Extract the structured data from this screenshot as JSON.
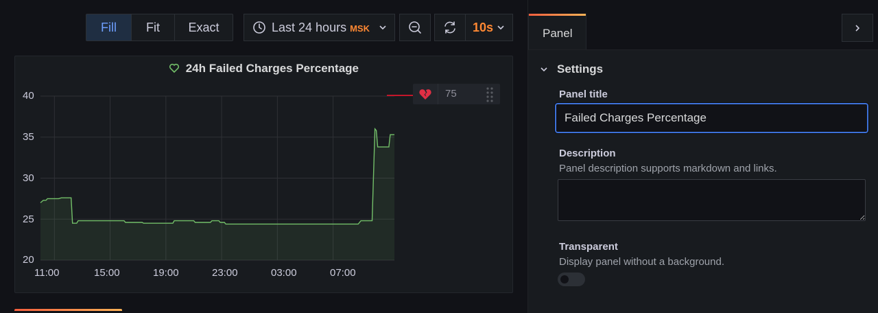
{
  "toolbar": {
    "fill_label": "Fill",
    "fit_label": "Fit",
    "exact_label": "Exact",
    "time_range": "Last 24 hours",
    "timezone": "MSK",
    "refresh_interval": "10s"
  },
  "panel": {
    "title": "24h Failed Charges Percentage",
    "threshold_value": "75"
  },
  "chart_data": {
    "type": "line",
    "title": "24h Failed Charges Percentage",
    "xlabel": "",
    "ylabel": "",
    "ylim": [
      20,
      40
    ],
    "yticks": [
      "40",
      "35",
      "30",
      "25",
      "20"
    ],
    "xticks": [
      "11:00",
      "15:00",
      "19:00",
      "23:00",
      "03:00",
      "07:00"
    ],
    "grid": true,
    "series": [
      {
        "values": [
          [
            10.0,
            27.0
          ],
          [
            10.2,
            27.3
          ],
          [
            10.4,
            27.3
          ],
          [
            10.5,
            27.5
          ],
          [
            11.3,
            27.5
          ],
          [
            11.5,
            27.6
          ],
          [
            12.2,
            27.6
          ],
          [
            12.3,
            24.5
          ],
          [
            12.6,
            24.5
          ],
          [
            12.7,
            24.8
          ],
          [
            16.0,
            24.8
          ],
          [
            16.1,
            24.6
          ],
          [
            17.3,
            24.6
          ],
          [
            17.4,
            24.5
          ],
          [
            19.5,
            24.5
          ],
          [
            19.6,
            24.8
          ],
          [
            21.0,
            24.8
          ],
          [
            21.1,
            24.6
          ],
          [
            22.2,
            24.6
          ],
          [
            22.3,
            24.8
          ],
          [
            22.8,
            24.8
          ],
          [
            22.9,
            24.6
          ],
          [
            23.2,
            24.6
          ],
          [
            23.3,
            24.4
          ],
          [
            32.8,
            24.4
          ],
          [
            33.0,
            24.8
          ],
          [
            33.8,
            24.8
          ],
          [
            34.0,
            36.0
          ],
          [
            34.1,
            35.8
          ],
          [
            34.2,
            33.8
          ],
          [
            35.0,
            33.8
          ],
          [
            35.1,
            35.3
          ],
          [
            35.4,
            35.3
          ]
        ]
      }
    ]
  },
  "sidepane": {
    "tab_label": "Panel",
    "section_label": "Settings",
    "title_label": "Panel title",
    "title_value": "Failed Charges Percentage",
    "description_label": "Description",
    "description_help": "Panel description supports markdown and links.",
    "transparent_label": "Transparent",
    "transparent_help": "Display panel without a background."
  },
  "colors": {
    "accent_orange": "#ff8833",
    "active_blue": "#6e9fff",
    "series_green": "#73bf69",
    "threshold_red": "#e02f44",
    "focus_blue": "#3d71d9"
  }
}
